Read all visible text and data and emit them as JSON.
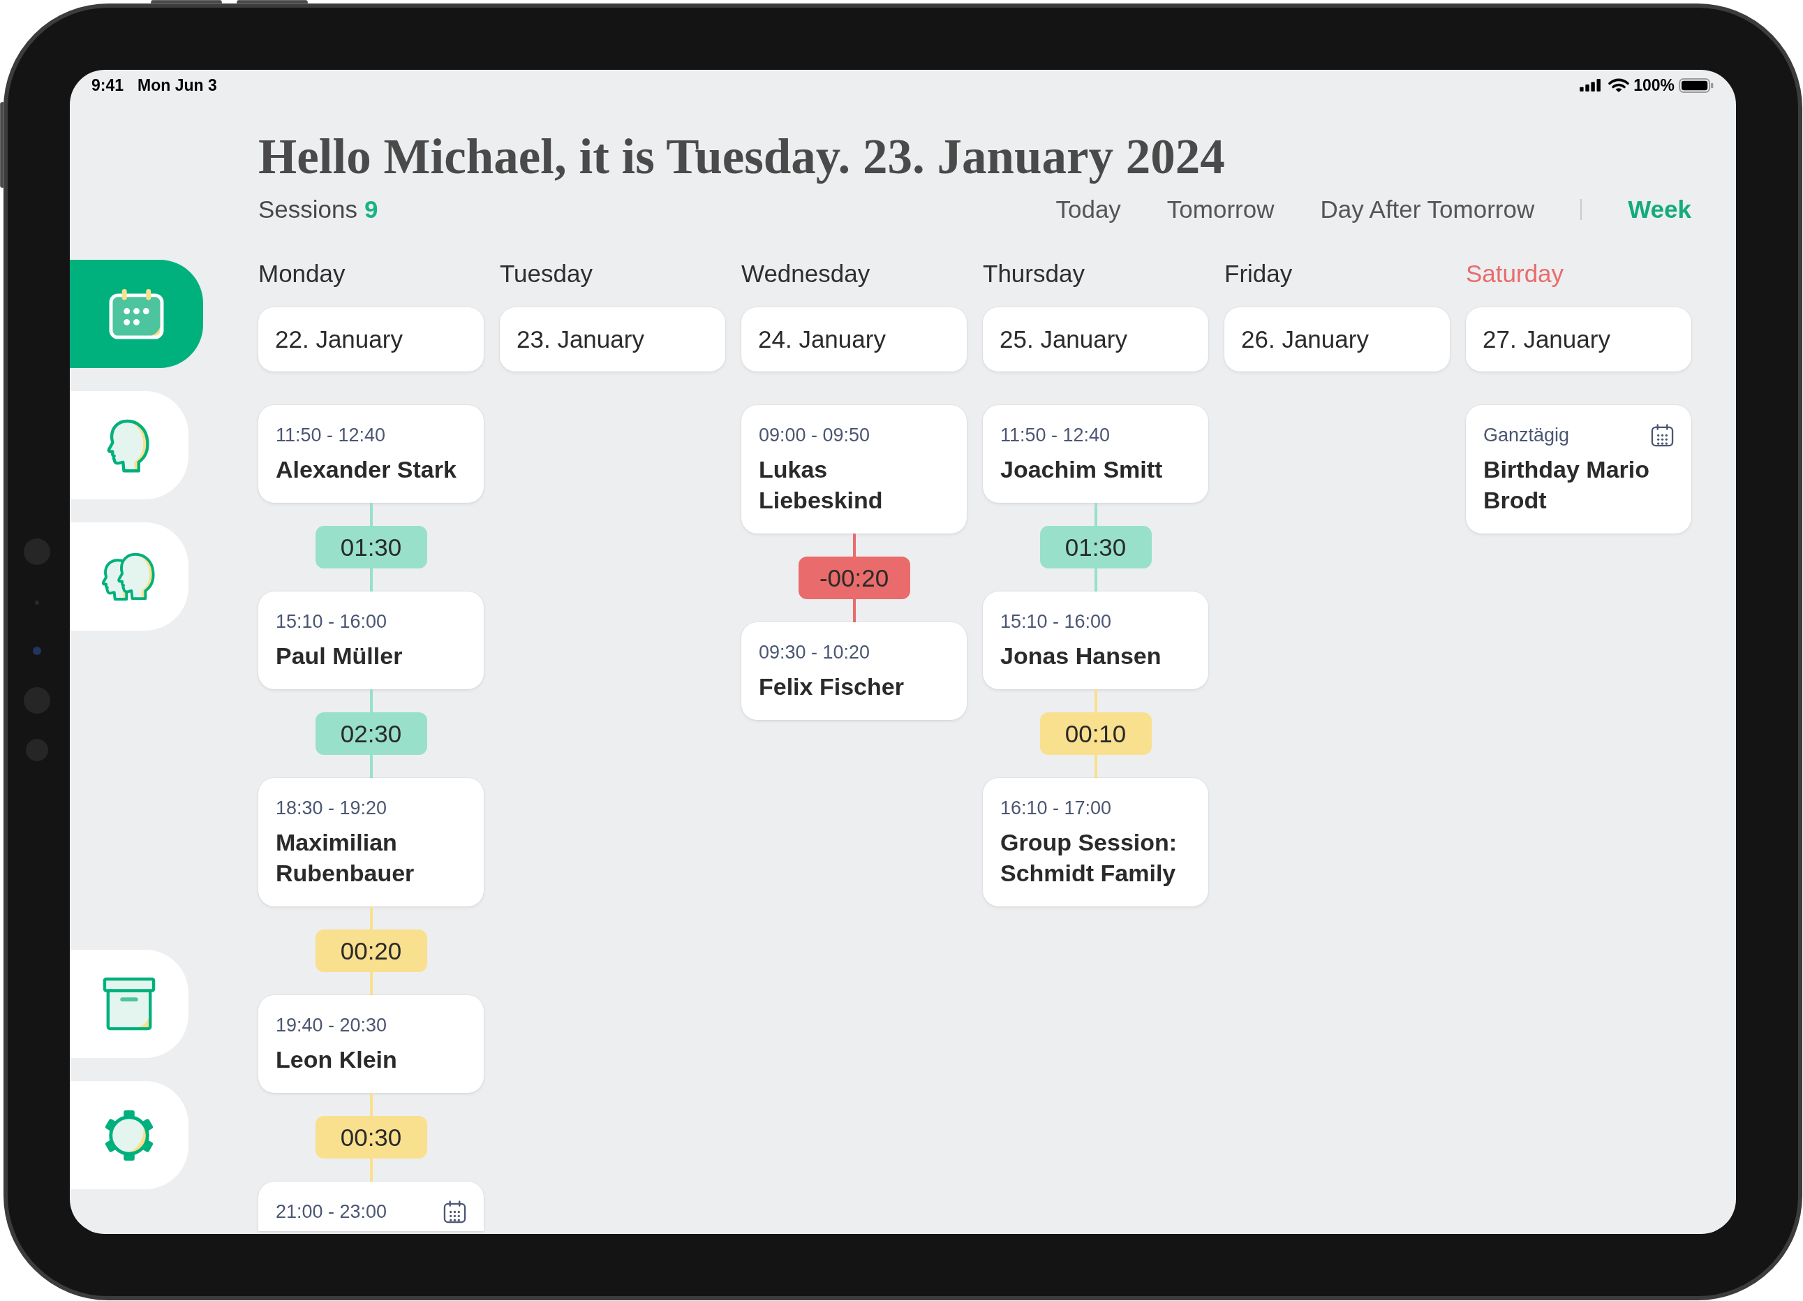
{
  "status_bar": {
    "time": "9:41",
    "date": "Mon Jun 3",
    "battery": "100%"
  },
  "header": {
    "greeting": "Hello Michael, it is Tuesday. 23. January 2024",
    "sessions_label": "Sessions",
    "sessions_count": "9"
  },
  "view_tabs": [
    {
      "label": "Today",
      "selected": false
    },
    {
      "label": "Tomorrow",
      "selected": false
    },
    {
      "label": "Day After Tomorrow",
      "selected": false
    },
    {
      "label": "Week",
      "selected": true
    }
  ],
  "sidebar": {
    "top_items": [
      {
        "selected": true
      },
      {
        "selected": false
      },
      {
        "selected": false
      }
    ],
    "bottom_items": [
      {
        "selected": false
      },
      {
        "selected": false
      }
    ]
  },
  "week": {
    "days": [
      {
        "weekday": "Monday",
        "date": "22. January",
        "weekend": false,
        "entries": [
          {
            "kind": "session",
            "time": "11:50 - 12:40",
            "title": "Alexander Stark"
          },
          {
            "kind": "gap",
            "duration": "01:30",
            "color": "#98e0ca"
          },
          {
            "kind": "session",
            "time": "15:10 - 16:00",
            "title": "Paul Müller"
          },
          {
            "kind": "gap",
            "duration": "02:30",
            "color": "#98e0ca"
          },
          {
            "kind": "session",
            "time": "18:30 - 19:20",
            "title": "Maximilian Rubenbauer"
          },
          {
            "kind": "gap",
            "duration": "00:20",
            "color": "#f9e08e"
          },
          {
            "kind": "session",
            "time": "19:40 - 20:30",
            "title": "Leon Klein"
          },
          {
            "kind": "gap",
            "duration": "00:30",
            "color": "#f9e08e"
          },
          {
            "kind": "event",
            "time": "21:00 - 23:00"
          }
        ]
      },
      {
        "weekday": "Tuesday",
        "date": "23. January",
        "weekend": false
      },
      {
        "weekday": "Wednesday",
        "date": "24. January",
        "weekend": false,
        "entries": [
          {
            "kind": "session",
            "time": "09:00 - 09:50",
            "title": "Lukas Liebeskind"
          },
          {
            "kind": "gap",
            "duration": "-00:20",
            "color": "#e96b6b"
          },
          {
            "kind": "session",
            "time": "09:30 - 10:20",
            "title": "Felix Fischer"
          }
        ]
      },
      {
        "weekday": "Thursday",
        "date": "25. January",
        "weekend": false,
        "entries": [
          {
            "kind": "session",
            "time": "11:50 - 12:40",
            "title": "Joachim Smitt"
          },
          {
            "kind": "gap",
            "duration": "01:30",
            "color": "#98e0ca"
          },
          {
            "kind": "session",
            "time": "15:10 - 16:00",
            "title": "Jonas Hansen"
          },
          {
            "kind": "gap",
            "duration": "00:10",
            "color": "#f9e08e"
          },
          {
            "kind": "session",
            "time": "16:10 - 17:00",
            "title": "Group Session: Schmidt Family"
          }
        ]
      },
      {
        "weekday": "Friday",
        "date": "26. January",
        "weekend": false
      },
      {
        "weekday": "Saturday",
        "date": "27. January",
        "weekend": true,
        "entries": [
          {
            "kind": "event",
            "time": "Ganztägig",
            "title": "Birthday Mario Brodt"
          }
        ]
      }
    ]
  }
}
